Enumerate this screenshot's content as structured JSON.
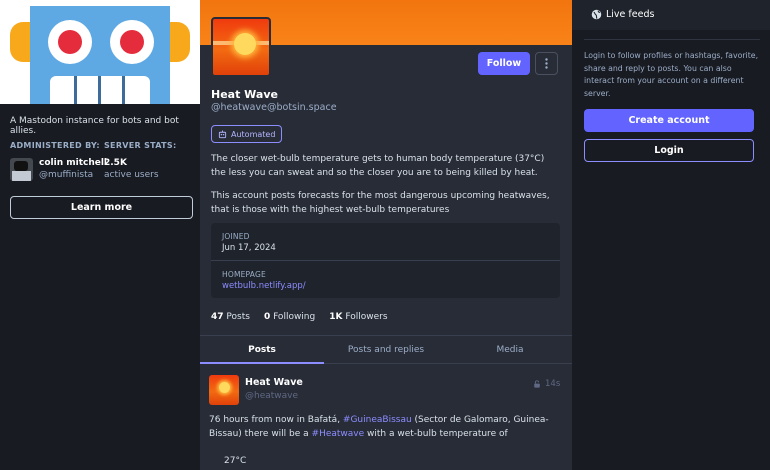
{
  "instance": {
    "tagline": "A Mastodon instance for bots and bot allies.",
    "administered_by_label": "ADMINISTERED BY:",
    "server_stats_label": "SERVER STATS:",
    "admin_name": "colin mitchell",
    "admin_handle": "@muffinista",
    "active_users_count": "2.5K",
    "active_users_label": "active users",
    "learn_more_label": "Learn more"
  },
  "profile": {
    "display_name": "Heat Wave",
    "handle": "@heatwave@botsin.space",
    "follow_label": "Follow",
    "more_icon": "ellipsis-vertical-icon",
    "badge_label": "Automated",
    "bio_paragraph_1": "The closer wet-bulb temperature gets to human body temperature (37°C) the less you can sweat and so the closer you are to being killed by heat.",
    "bio_paragraph_2": "This account posts forecasts for the most dangerous upcoming heatwaves, that is those with the highest wet-bulb temperatures",
    "fields": {
      "joined_label": "JOINED",
      "joined_value": "Jun 17, 2024",
      "homepage_label": "HOMEPAGE",
      "homepage_value": "wetbulb.netlify.app/"
    },
    "counts": {
      "posts_num": "47",
      "posts_label": "Posts",
      "following_num": "0",
      "following_label": "Following",
      "followers_num": "1K",
      "followers_label": "Followers"
    },
    "tabs": [
      "Posts",
      "Posts and replies",
      "Media"
    ],
    "accent_color": "#6364ff"
  },
  "post": {
    "author_name": "Heat Wave",
    "author_handle": "@heatwave",
    "time": "14s",
    "text_before_tag1": "76 hours from now in Bafatá, ",
    "tag1": "#GuineaBissau",
    "text_mid": " (Sector de Galomaro, Guinea-Bissau) there will be a ",
    "tag2": "#Heatwave",
    "text_after": " with a wet-bulb temperature of",
    "temperature": "27°C"
  },
  "sidebar_right": {
    "title": "Live feeds",
    "description": "Login to follow profiles or hashtags, favorite, share and reply to posts. You can also interact from your account on a different server.",
    "create_account_label": "Create account",
    "login_label": "Login"
  }
}
